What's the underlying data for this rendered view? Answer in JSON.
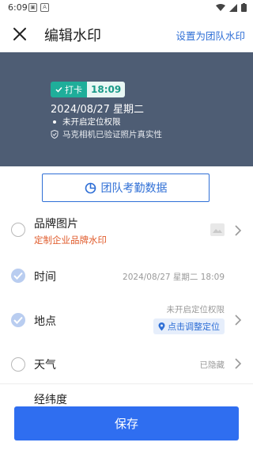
{
  "status_bar": {
    "time": "6:09"
  },
  "header": {
    "title": "编辑水印",
    "team_watermark_link": "设置为团队水印"
  },
  "watermark_preview": {
    "punch_label": "打卡",
    "time": "18:09",
    "date_line": "2024/08/27  星期二",
    "location_line": "未开启定位权限",
    "verify_line": "马克相机已验证照片真实性"
  },
  "team_attendance_button": "团队考勤数据",
  "items": [
    {
      "label": "品牌图片",
      "sublabel": "定制企业品牌水印",
      "checked": false
    },
    {
      "label": "时间",
      "value": "2024/08/27 星期二 18:09",
      "checked": true
    },
    {
      "label": "地点",
      "value": "未开启定位权限",
      "action": "点击调整定位",
      "checked": true
    },
    {
      "label": "天气",
      "value": "已隐藏",
      "checked": false
    },
    {
      "label": "经纬度",
      "checked": false
    }
  ],
  "save_button": "保存",
  "colors": {
    "accent": "#2f6ef0",
    "link": "#2f6fd6",
    "preview_bg": "#4e5d74",
    "punch_tag": "#1fae9a",
    "brand_sub": "#e05a2a"
  }
}
